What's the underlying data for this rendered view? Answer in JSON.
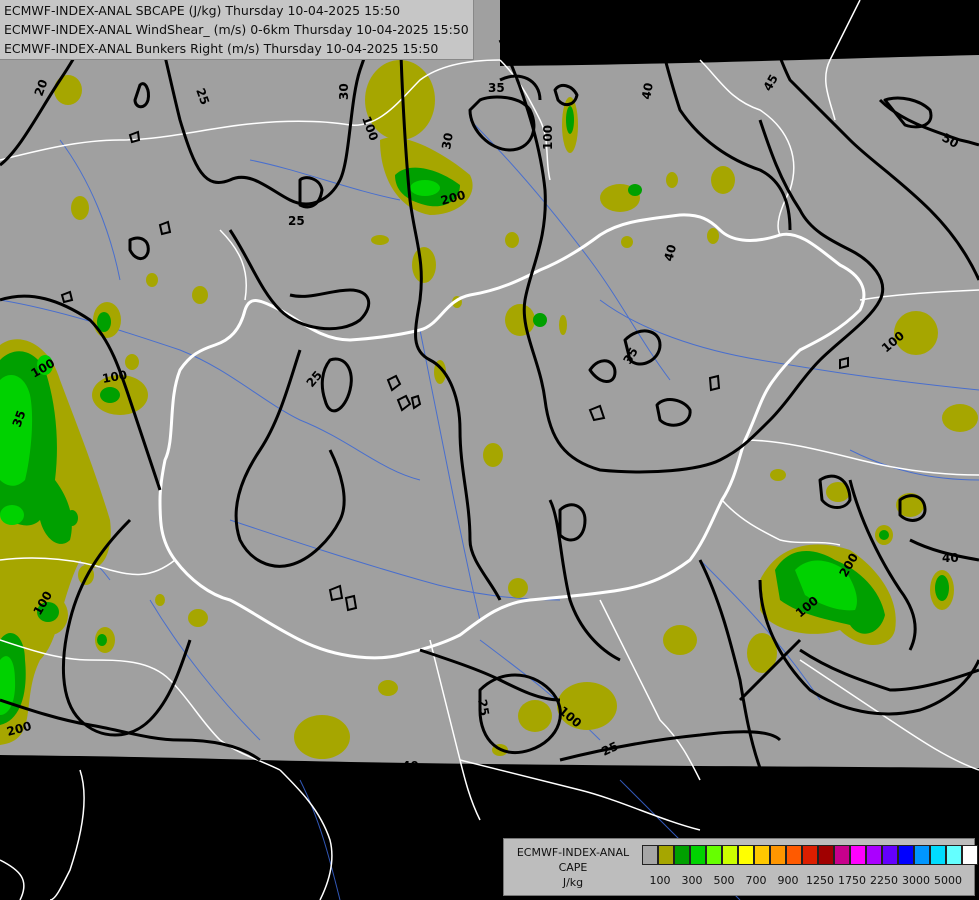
{
  "header": {
    "lines": [
      "ECMWF-INDEX-ANAL SBCAPE (J/kg) Thursday 10-04-2025 15:50",
      "ECMWF-INDEX-ANAL WindShear_ (m/s) 0-6km Thursday 10-04-2025 15:50",
      "ECMWF-INDEX-ANAL Bunkers Right (m/s) Thursday 10-04-2025 15:50"
    ]
  },
  "legend": {
    "title": [
      "ECMWF-INDEX-ANAL",
      "CAPE",
      "J/kg"
    ],
    "colors": [
      "#a6a6a6",
      "#a6a600",
      "#00a000",
      "#00d200",
      "#66ff00",
      "#ccff00",
      "#ffff00",
      "#ffc800",
      "#ff9600",
      "#ff5a00",
      "#dc1e00",
      "#a00000",
      "#c8008c",
      "#ff00ff",
      "#aa00ff",
      "#6400ff",
      "#0000ff",
      "#0096ff",
      "#00dcff",
      "#64ffff",
      "#ffffff"
    ],
    "ticks": [
      "100",
      "300",
      "500",
      "700",
      "900",
      "1250",
      "1750",
      "2250",
      "3000",
      "5000"
    ]
  },
  "map": {
    "colors": {
      "domain": "#a0a0a0",
      "outside": "#000000",
      "cape_100": "#a6a600",
      "cape_300": "#00a000",
      "cape_500": "#00d200",
      "border": "#ffffff",
      "river": "#3a66d6",
      "contour": "#000000"
    },
    "contour_labels": [
      "20",
      "25",
      "30",
      "35",
      "40",
      "45",
      "50",
      "30",
      "200",
      "100",
      "25",
      "40",
      "35",
      "25",
      "100",
      "100",
      "35",
      "100",
      "40",
      "25",
      "25",
      "100",
      "200",
      "100",
      "100",
      "100",
      "200",
      "40"
    ]
  }
}
